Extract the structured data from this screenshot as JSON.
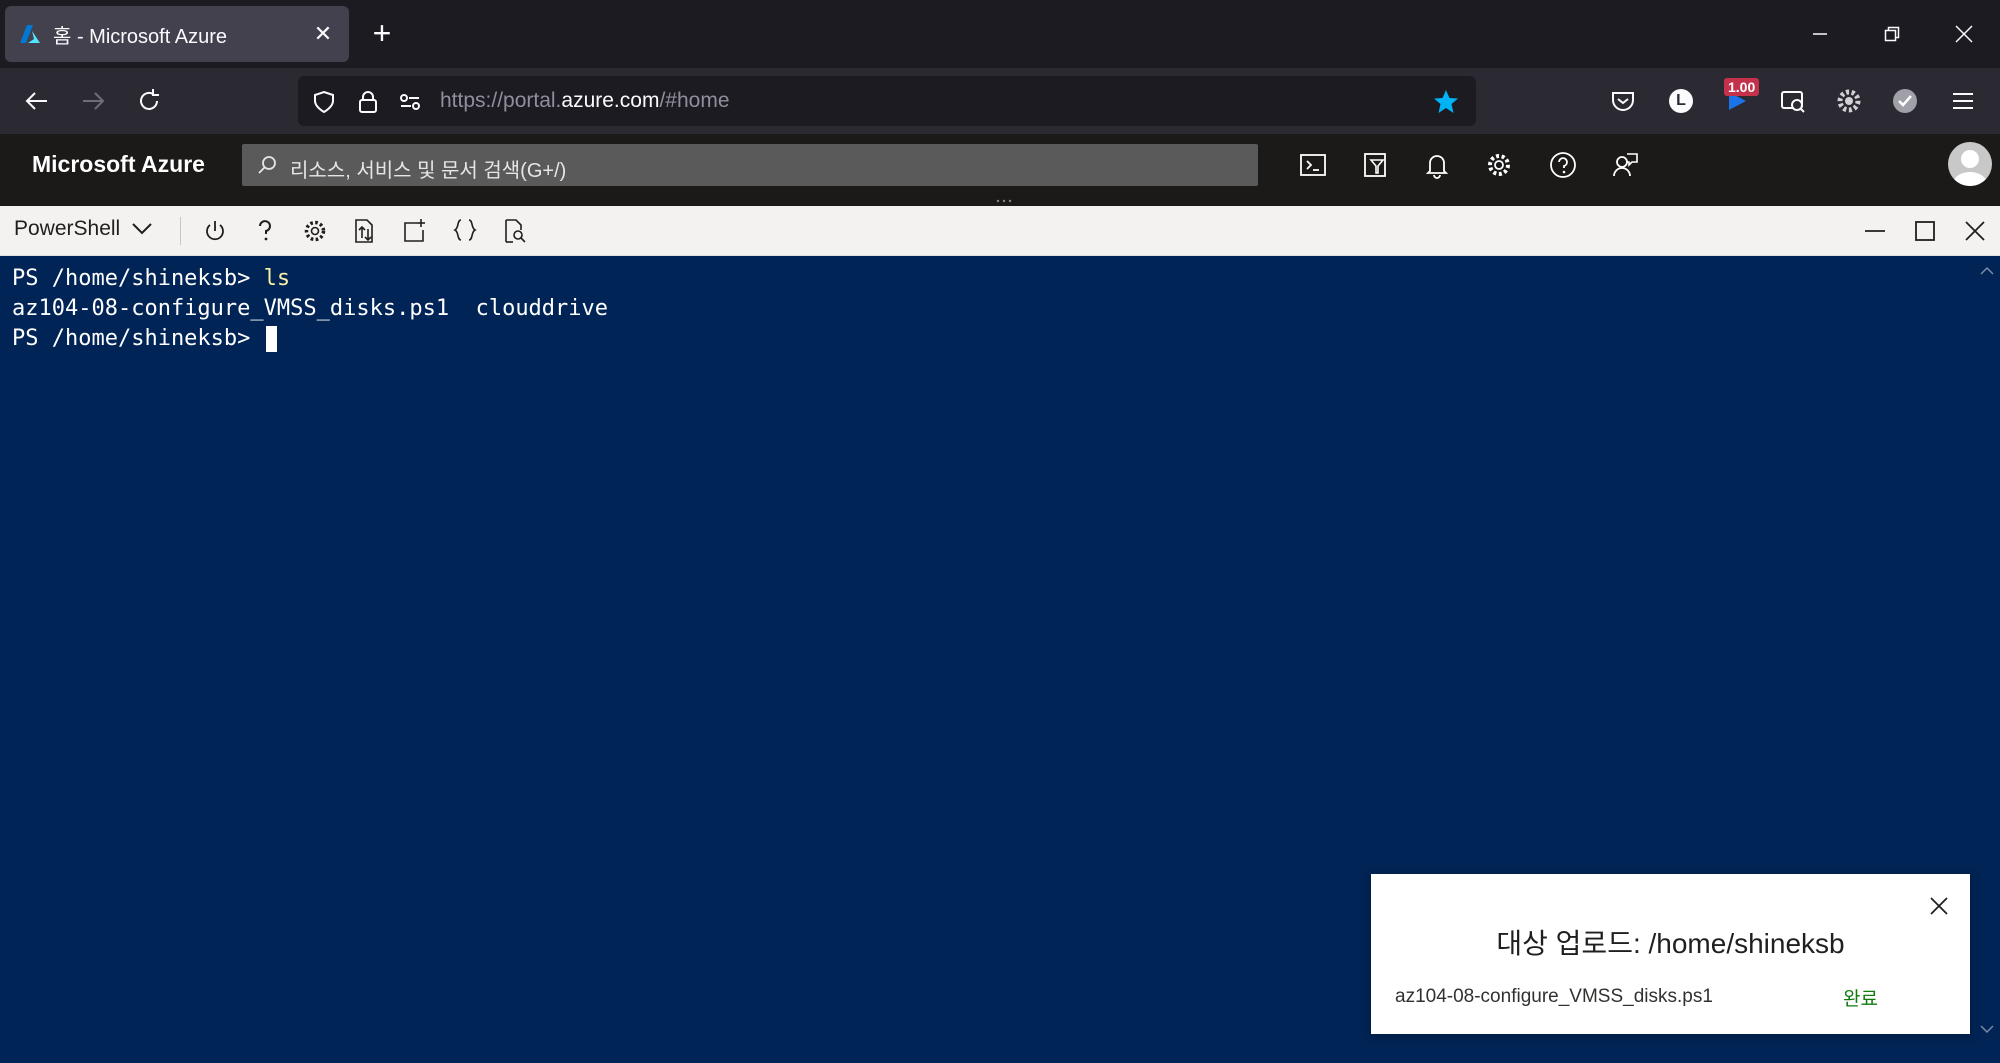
{
  "browser": {
    "tab_title": "홈 - Microsoft Azure",
    "url_prefix": "https://portal.",
    "url_host": "azure.com",
    "url_suffix": "/#home",
    "extension_badge": "1.00",
    "profile_initial": "L"
  },
  "azure": {
    "brand": "Microsoft Azure",
    "search_placeholder": "리소스, 서비스 및 문서 검색(G+/)"
  },
  "shell": {
    "selector_label": "PowerShell",
    "terminal_lines": [
      {
        "prompt": "PS /home/shineksb> ",
        "command": "ls"
      },
      {
        "output": "az104-08-configure_VMSS_disks.ps1  clouddrive"
      },
      {
        "prompt": "PS /home/shineksb> ",
        "command": ""
      }
    ]
  },
  "upload": {
    "title": "대상 업로드: /home/shineksb",
    "file_name": "az104-08-configure_VMSS_disks.ps1",
    "status": "완료"
  },
  "colors": {
    "terminal_bg": "#012456",
    "command_text": "#f9f1a5",
    "status_green": "#107c10",
    "bookmark_star": "#00b3f4"
  }
}
